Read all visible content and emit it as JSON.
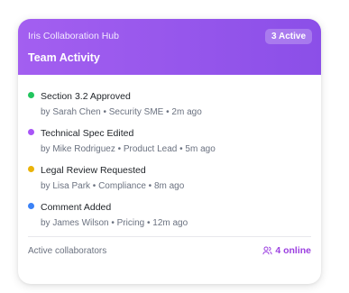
{
  "header": {
    "hub_name": "Iris Collaboration Hub",
    "badge": "3 Active",
    "title": "Team Activity",
    "gradient_start": "#a35ff0",
    "gradient_end": "#8b4fe8"
  },
  "activities": [
    {
      "title": "Section 3.2 Approved",
      "meta": "by Sarah Chen • Security SME • 2m ago",
      "dot_color": "#22c55e"
    },
    {
      "title": "Technical Spec Edited",
      "meta": "by Mike Rodriguez • Product Lead • 5m ago",
      "dot_color": "#a855f7"
    },
    {
      "title": "Legal Review Requested",
      "meta": "by Lisa Park • Compliance • 8m ago",
      "dot_color": "#eab308"
    },
    {
      "title": "Comment Added",
      "meta": "by James Wilson • Pricing • 12m ago",
      "dot_color": "#3b82f6"
    }
  ],
  "footer": {
    "label": "Active collaborators",
    "online": "4 online",
    "online_icon": "users-icon",
    "online_color": "#9b3fe0"
  }
}
